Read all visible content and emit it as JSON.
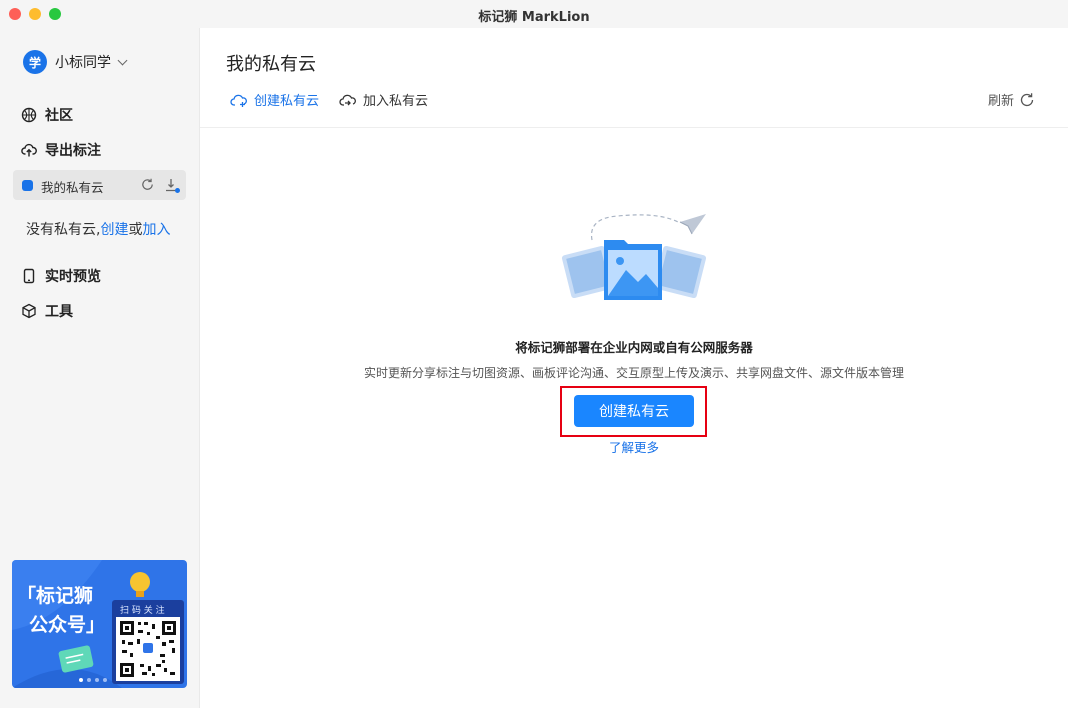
{
  "window": {
    "title": "标记狮 MarkLion"
  },
  "user": {
    "avatar_text": "学",
    "name": "小标同学"
  },
  "sidebar": {
    "community": "社区",
    "export": "导出标注",
    "private_cloud": "我的私有云",
    "no_cloud_prefix": "没有私有云,",
    "no_cloud_create": "创建",
    "no_cloud_or": "或",
    "no_cloud_join": "加入",
    "preview": "实时预览",
    "tools": "工具"
  },
  "banner": {
    "title_line1": "「标记狮",
    "title_line2": "公众号」",
    "scan_label": "扫 码 关 注"
  },
  "main": {
    "title": "我的私有云",
    "create_cloud": "创建私有云",
    "join_cloud": "加入私有云",
    "refresh": "刷新",
    "headline": "将标记狮部署在企业内网或自有公网服务器",
    "description": "实时更新分享标注与切图资源、画板评论沟通、交互原型上传及演示、共享网盘文件、源文件版本管理",
    "create_button": "创建私有云",
    "learn_more": "了解更多"
  },
  "colors": {
    "accent": "#1a86ff",
    "highlight": "#e60012",
    "sidebar_bg": "#f5f5f5"
  }
}
